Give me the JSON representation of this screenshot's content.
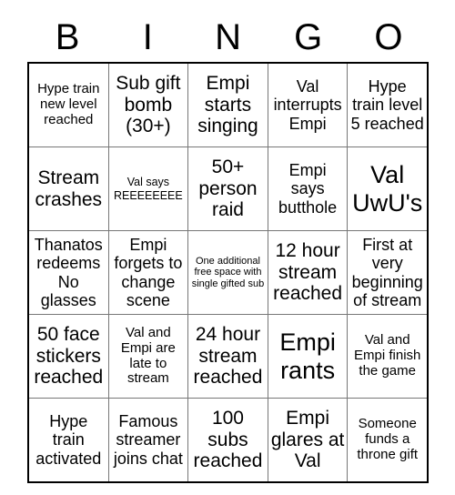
{
  "card": {
    "header_letters": [
      "B",
      "I",
      "N",
      "G",
      "O"
    ],
    "columns": 5,
    "rows": 5,
    "colors": {
      "background": "#ffffff",
      "text": "#000000",
      "grid_line": "#777777",
      "grid_border": "#000000"
    },
    "cells": [
      [
        {
          "text": "Hype train new level reached",
          "size": "fs-sm"
        },
        {
          "text": "Sub gift bomb (30+)",
          "size": "fs-lg"
        },
        {
          "text": "Empi starts singing",
          "size": "fs-lg"
        },
        {
          "text": "Val interrupts Empi",
          "size": "fs-md"
        },
        {
          "text": "Hype train level 5 reached",
          "size": "fs-md"
        }
      ],
      [
        {
          "text": "Stream crashes",
          "size": "fs-lg"
        },
        {
          "text": "Val says REEEEEEEE",
          "size": "fs-xs"
        },
        {
          "text": "50+ person raid",
          "size": "fs-lg"
        },
        {
          "text": "Empi says butthole",
          "size": "fs-md"
        },
        {
          "text": "Val UwU's",
          "size": "fs-xl"
        }
      ],
      [
        {
          "text": "Thanatos redeems No glasses",
          "size": "fs-md"
        },
        {
          "text": "Empi forgets to change scene",
          "size": "fs-md"
        },
        {
          "text": "One additional free space with single gifted sub",
          "size": "fs-xxs"
        },
        {
          "text": "12 hour stream reached",
          "size": "fs-lg"
        },
        {
          "text": "First at very beginning of stream",
          "size": "fs-md"
        }
      ],
      [
        {
          "text": "50 face stickers reached",
          "size": "fs-lg"
        },
        {
          "text": "Val and Empi are late to stream",
          "size": "fs-sm"
        },
        {
          "text": "24 hour stream reached",
          "size": "fs-lg"
        },
        {
          "text": "Empi rants",
          "size": "fs-xl"
        },
        {
          "text": "Val and Empi finish the game",
          "size": "fs-sm"
        }
      ],
      [
        {
          "text": "Hype train activated",
          "size": "fs-md"
        },
        {
          "text": "Famous streamer joins chat",
          "size": "fs-md"
        },
        {
          "text": "100 subs reached",
          "size": "fs-lg"
        },
        {
          "text": "Empi glares at Val",
          "size": "fs-lg"
        },
        {
          "text": "Someone funds a throne gift",
          "size": "fs-sm"
        }
      ]
    ]
  }
}
